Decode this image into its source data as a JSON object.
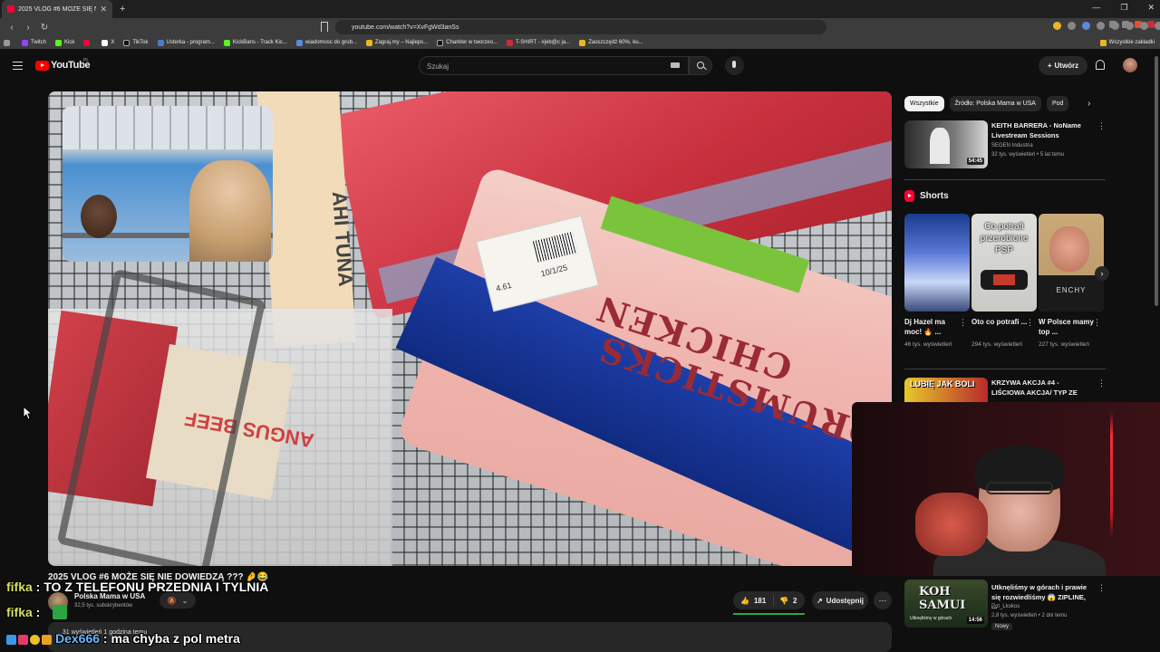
{
  "browser": {
    "tab_title": "2025 VLOG #6 MOŻE SIĘ NIE",
    "url": "youtube.com/watch?v=XvFgWd3anSs",
    "bookmarks": [
      "Twitch",
      "Kick",
      "X",
      "TikTok",
      "Usterka - program...",
      "KickBans - Track Kic...",
      "wiadomosc do grub...",
      "Zagraj.my – Najleps...",
      "Charkter w tworzeo...",
      "T-SHIRT - #jeb@c ja...",
      "Zaoszczędź 60%, ku..."
    ],
    "all_bookmarks": "Wszystkie zakładki"
  },
  "header": {
    "logo": "YouTube",
    "country": "PL",
    "search_placeholder": "Szukaj",
    "create_label": "Utwórz"
  },
  "video": {
    "title": "2025 VLOG #6 MOŻE SIĘ NIE DOWIEDZĄ ??? 🤌😂",
    "bag_text_1": "CHICKEN",
    "bag_text_2": "DRUMSTICKS",
    "price": "4.61",
    "date": "10/1/25",
    "tuna_text": "AHI TUNA",
    "beef_text": "ANGUS BEEF",
    "channel": "Polska Mama w USA",
    "subscribers": "32,5 tys. subskrybentów",
    "likes": "181",
    "dislikes": "2",
    "share_label": "Udostępnij",
    "description": "...31 wyświetleń  1 godzina temu"
  },
  "sidebar": {
    "chips": [
      "Wszystkie",
      "Źródło: Polska Mama w USA",
      "Pod"
    ],
    "rec1": {
      "title": "KEITH BARRERA - NoName Livestream Sessions",
      "channel": "SEGEN Industria",
      "meta": "32 tys. wyświetleń • 5 lat temu",
      "duration": "54:45"
    },
    "shorts_label": "Shorts",
    "shorts": [
      {
        "title": "Dj Hazel ma moc! 🔥 ...",
        "views": "46 tys. wyświetleń"
      },
      {
        "title": "Oto co potrafi ...",
        "views": "294 tys. wyświetleń",
        "overlay": "Co potrafi przerobione PSP"
      },
      {
        "title": "W Polsce mamy top ...",
        "views": "227 tys. wyświetleń",
        "overlay": "ENCHY"
      }
    ],
    "rec2": {
      "title": "KRZYWA AKCJA #4 - LIŚCIOWA AKCJA/ TYP ZE SNAPA/ ...",
      "thumb": "LUBIĘ JAK BOLI"
    },
    "rec3": {
      "title": "Utknęliśmy w górach i prawie się rozwiedliśmy 😱 ZIPLINE, ...",
      "channel": "Pot_Lkokos",
      "meta": "2,8 tys. wyświetleń • 2 dni temu",
      "duration": "14:56",
      "badge": "Nowy",
      "thumb": "KOH SAMUI",
      "thumb_sub": "Utknęliśmy w górach"
    }
  },
  "chat": [
    {
      "user": "fifka",
      "message": "TO Z TELEFONU PRZEDNIA I TYLNIA"
    },
    {
      "user": "fifka",
      "message": ""
    },
    {
      "user": "Dex666",
      "message": "ma chyba z pol metra"
    }
  ],
  "colors": {
    "bg": "#0f0f0f",
    "yt_red": "#ff0000",
    "chat_user": "#d8e060",
    "chat_user2": "#6ab8ff"
  }
}
